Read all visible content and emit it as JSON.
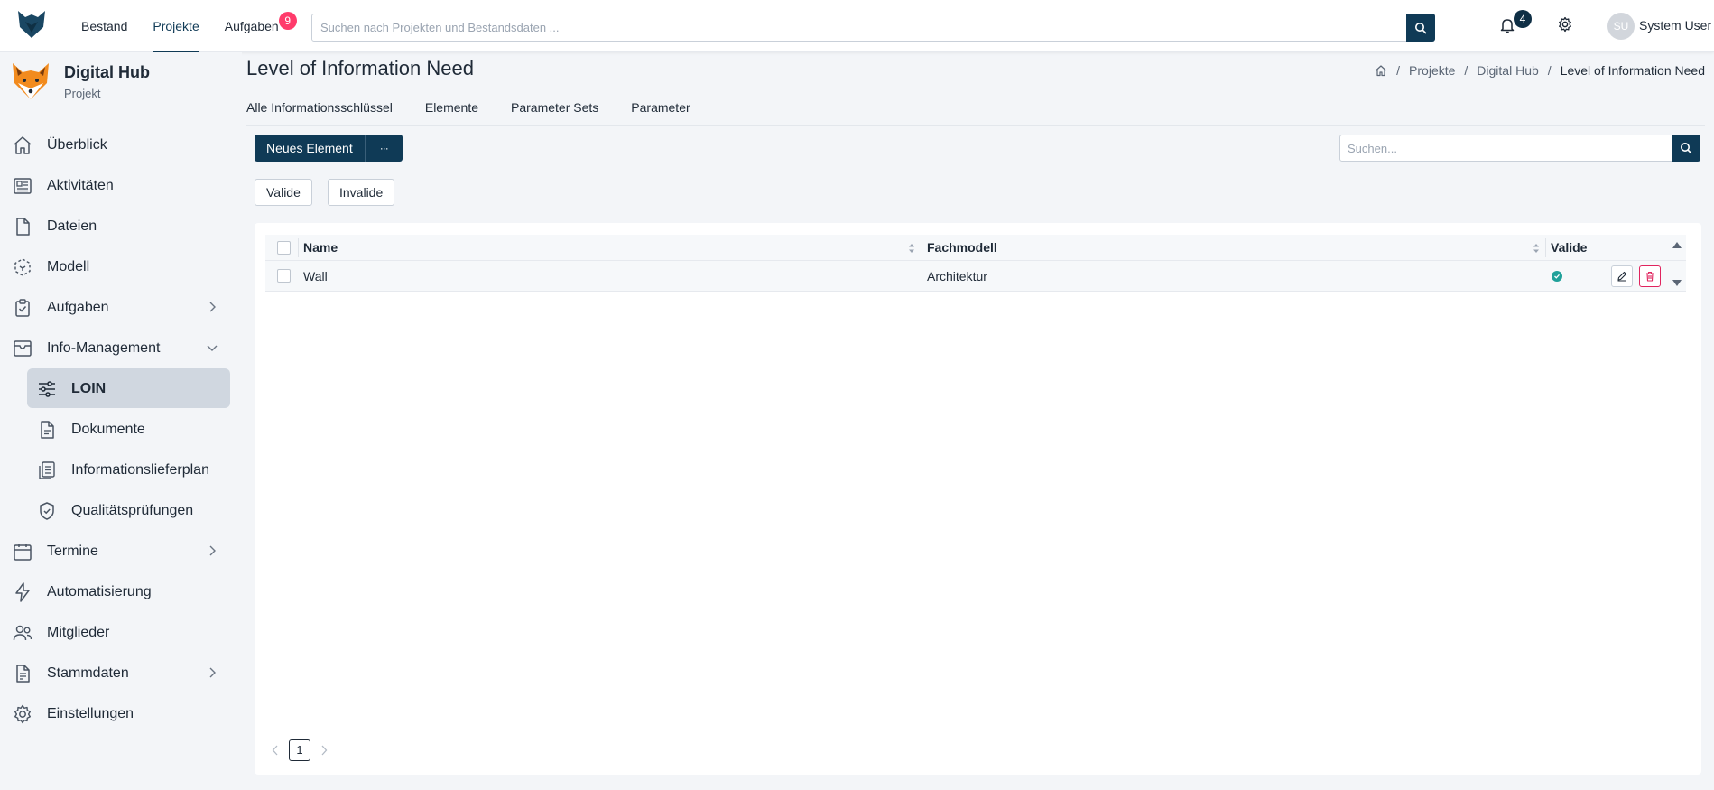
{
  "topnav": {
    "items": [
      {
        "label": "Bestand"
      },
      {
        "label": "Projekte"
      },
      {
        "label": "Aufgaben",
        "badge": "9"
      }
    ],
    "search_placeholder": "Suchen nach Projekten und Bestandsdaten ...",
    "notification_count": "4",
    "user_initials": "SU",
    "user_name": "System User"
  },
  "sidebar": {
    "project_title": "Digital Hub",
    "project_subtitle": "Projekt",
    "items": [
      {
        "label": "Überblick"
      },
      {
        "label": "Aktivitäten"
      },
      {
        "label": "Dateien"
      },
      {
        "label": "Modell"
      },
      {
        "label": "Aufgaben"
      },
      {
        "label": "Info-Management"
      },
      {
        "label": "LOIN"
      },
      {
        "label": "Dokumente"
      },
      {
        "label": "Informationslieferplan"
      },
      {
        "label": "Qualitätsprüfungen"
      },
      {
        "label": "Termine"
      },
      {
        "label": "Automatisierung"
      },
      {
        "label": "Mitglieder"
      },
      {
        "label": "Stammdaten"
      },
      {
        "label": "Einstellungen"
      }
    ]
  },
  "main": {
    "title": "Level of Information Need",
    "breadcrumb": [
      "Projekte",
      "Digital Hub",
      "Level of Information Need"
    ],
    "breadcrumb_sep": "/",
    "tabs": [
      {
        "label": "Alle Informationsschlüssel"
      },
      {
        "label": "Elemente"
      },
      {
        "label": "Parameter Sets"
      },
      {
        "label": "Parameter"
      }
    ],
    "new_button": "Neues Element",
    "more_button": "···",
    "search_placeholder": "Suchen...",
    "filters": {
      "valid": "Valide",
      "invalid": "Invalide"
    },
    "table": {
      "columns": [
        "Name",
        "Fachmodell",
        "Valide"
      ],
      "rows": [
        {
          "name": "Wall",
          "fachmodell": "Architektur",
          "valid": true
        }
      ]
    },
    "pagination": {
      "current": "1"
    }
  },
  "colors": {
    "primary": "#0f3a56",
    "badge_red": "#ff3b6b",
    "valid_green": "#20a19a",
    "delete_red": "#e0245e",
    "active_nav_bg": "#d0d7e0"
  }
}
